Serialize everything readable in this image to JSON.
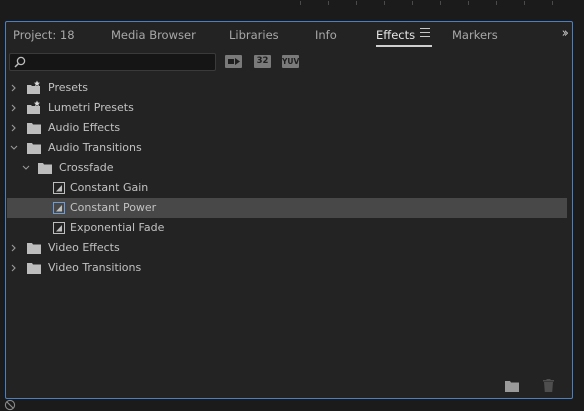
{
  "tabs": [
    {
      "label": "Project: 18"
    },
    {
      "label": "Media Browser"
    },
    {
      "label": "Libraries"
    },
    {
      "label": "Info"
    },
    {
      "label": "Effects",
      "active": true
    },
    {
      "label": "Markers"
    }
  ],
  "search": {
    "value": "",
    "placeholder": ""
  },
  "filters": {
    "accelerated": "",
    "bit32": "32",
    "yuv": "YUV"
  },
  "tree": [
    {
      "label": "Presets",
      "type": "preset-folder",
      "expanded": false
    },
    {
      "label": "Lumetri Presets",
      "type": "preset-folder",
      "expanded": false
    },
    {
      "label": "Audio Effects",
      "type": "folder",
      "expanded": false
    },
    {
      "label": "Audio Transitions",
      "type": "folder",
      "expanded": true
    },
    {
      "label": "Crossfade",
      "type": "folder",
      "expanded": true
    },
    {
      "label": "Constant Gain",
      "type": "effect"
    },
    {
      "label": "Constant Power",
      "type": "effect",
      "selected": true
    },
    {
      "label": "Exponential Fade",
      "type": "effect"
    },
    {
      "label": "Video Effects",
      "type": "folder",
      "expanded": false
    },
    {
      "label": "Video Transitions",
      "type": "folder",
      "expanded": false
    }
  ],
  "colors": {
    "panel_bg": "#232323",
    "focus_border": "#4b7fc4",
    "selected_row": "#484848",
    "text": "#c2c2c2"
  }
}
